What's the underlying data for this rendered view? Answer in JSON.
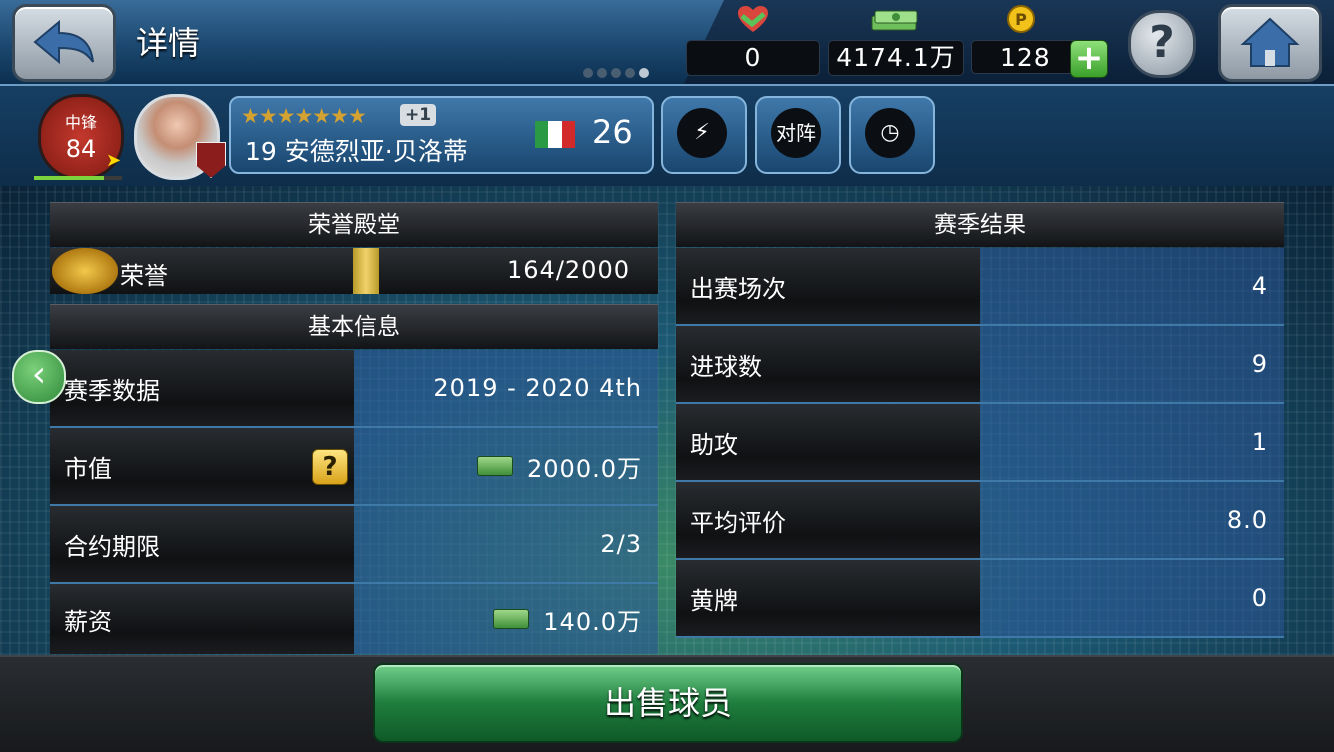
{
  "header": {
    "title": "详情",
    "resources": {
      "fans": "0",
      "money": "4174.1万",
      "points": "128"
    },
    "icons": [
      "back-arrow-icon",
      "handshake-icon",
      "money-stack-icon",
      "coin-p-icon",
      "help-icon",
      "home-icon",
      "plus-icon"
    ]
  },
  "player": {
    "position": "中锋",
    "overall": "84",
    "stars": "★★★★★★★",
    "star_bonus": "+1",
    "name": "19 安德烈亚·贝洛蒂",
    "age": "26",
    "flag_colors": [
      "#2a9a45",
      "#ffffff",
      "#d22a2a"
    ],
    "position_progress": 0.8,
    "lineup_label": "对阵"
  },
  "left_panel": {
    "hall_title": "荣誉殿堂",
    "honor_label": "荣誉",
    "honor_value": "164/2000",
    "basic_title": "基本信息",
    "rows": [
      {
        "label": "赛季数据",
        "value": "2019 - 2020 4th"
      },
      {
        "label": "市值",
        "value": "2000.0万"
      },
      {
        "label": "合约期限",
        "value": "2/3"
      },
      {
        "label": "薪资",
        "value": "140.0万"
      }
    ],
    "help_label": "?"
  },
  "right_panel": {
    "title": "赛季结果",
    "rows": [
      {
        "label": "出赛场次",
        "value": "4"
      },
      {
        "label": "进球数",
        "value": "9"
      },
      {
        "label": "助攻",
        "value": "1"
      },
      {
        "label": "平均评价",
        "value": "8.0"
      },
      {
        "label": "黄牌",
        "value": "0"
      }
    ]
  },
  "footer": {
    "sell_label": "出售球员"
  }
}
